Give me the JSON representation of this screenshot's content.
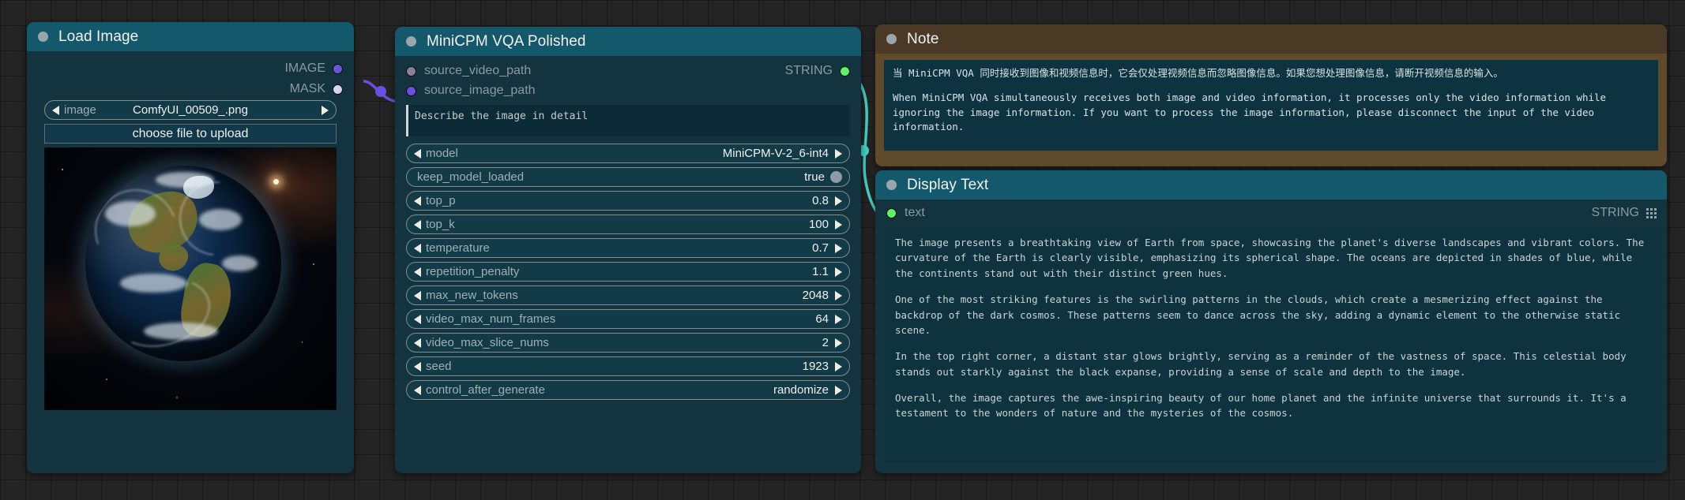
{
  "nodes": {
    "load_image": {
      "title": "Load Image",
      "outputs": [
        {
          "label": "IMAGE",
          "color": "#6a56d6"
        },
        {
          "label": "MASK",
          "color": "#d8d2f0"
        }
      ],
      "image_widget": {
        "name": "image",
        "value": "ComfyUI_00509_.png"
      },
      "upload_button": "choose file to upload"
    },
    "minicpm": {
      "title": "MiniCPM VQA Polished",
      "inputs": [
        {
          "label": "source_video_path",
          "color": "#8a7f9a"
        },
        {
          "label": "source_image_path",
          "color": "#6a4fe0"
        }
      ],
      "outputs": [
        {
          "label": "STRING",
          "color": "#5cf26b"
        }
      ],
      "prompt": "Describe the image in detail",
      "widgets": [
        {
          "name": "model",
          "value": "MiniCPM-V-2_6-int4",
          "type": "combo"
        },
        {
          "name": "keep_model_loaded",
          "value": "true",
          "type": "toggle"
        },
        {
          "name": "top_p",
          "value": "0.8",
          "type": "number"
        },
        {
          "name": "top_k",
          "value": "100",
          "type": "number"
        },
        {
          "name": "temperature",
          "value": "0.7",
          "type": "number"
        },
        {
          "name": "repetition_penalty",
          "value": "1.1",
          "type": "number"
        },
        {
          "name": "max_new_tokens",
          "value": "2048",
          "type": "number"
        },
        {
          "name": "video_max_num_frames",
          "value": "64",
          "type": "number"
        },
        {
          "name": "video_max_slice_nums",
          "value": "2",
          "type": "number"
        },
        {
          "name": "seed",
          "value": "1923",
          "type": "number"
        },
        {
          "name": "control_after_generate",
          "value": "randomize",
          "type": "combo"
        }
      ]
    },
    "note": {
      "title": "Note",
      "text_zh": "当 MiniCPM VQA 同时接收到图像和视频信息时，它会仅处理视频信息而忽略图像信息。如果您想处理图像信息，请断开视频信息的输入。",
      "text_en": "When MiniCPM VQA simultaneously receives both image and video information, it processes only the video information while ignoring the image information. If you want to process the image information, please disconnect the input of the video information."
    },
    "display_text": {
      "title": "Display Text",
      "input": {
        "label": "text",
        "color": "#5cf26b"
      },
      "output": {
        "label": "STRING"
      },
      "paragraphs": [
        "The image presents a breathtaking view of Earth from space, showcasing the planet's diverse landscapes and vibrant colors. The curvature of the Earth is clearly visible, emphasizing its spherical shape. The oceans are depicted in shades of blue, while the continents stand out with their distinct green hues.",
        "One of the most striking features is the swirling patterns in the clouds, which create a mesmerizing effect against the backdrop of the dark cosmos. These patterns seem to dance across the sky, adding a dynamic element to the otherwise static scene.",
        "In the top right corner, a distant star glows brightly, serving as a reminder of the vastness of space. This celestial body stands out starkly against the black expanse, providing a sense of scale and depth to the image.",
        "Overall, the image captures the awe-inspiring beauty of our home planet and the infinite universe that surrounds it. It's a testament to the wonders of nature and the mysteries of the cosmos."
      ]
    }
  },
  "links": [
    {
      "from": "IMAGE",
      "to": "source_image_path",
      "color": "#6a4fe0"
    },
    {
      "from": "STRING",
      "to": "text",
      "color": "#3fd6c6"
    }
  ],
  "colors": {
    "canvas_bg": "#242424",
    "node_bg": "#13343f",
    "node_title": "#14596b",
    "note_bg": "#5f4b2b",
    "note_title": "#4a3a25"
  }
}
